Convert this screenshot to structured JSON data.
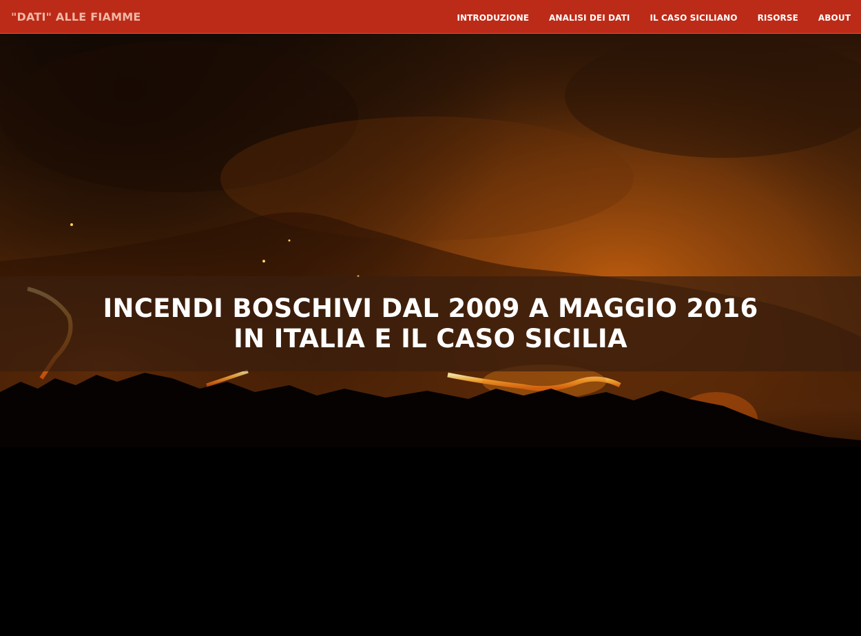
{
  "nav": {
    "brand": "\"DATI\" ALLE FIAMME",
    "links": [
      {
        "label": "INTRODUZIONE"
      },
      {
        "label": "ANALISI DEI DATI"
      },
      {
        "label": "IL CASO SICILIANO"
      },
      {
        "label": "RISORSE"
      },
      {
        "label": "ABOUT"
      }
    ]
  },
  "hero": {
    "title": "INCENDI BOSCHIVI DAL 2009 A MAGGIO 2016 IN ITALIA E IL CASO SICILIA"
  },
  "colors": {
    "navbar_bg": "#bc2b18",
    "brand_text": "#f2b8a6",
    "nav_text": "#ffffff",
    "title_text": "#ffffff"
  }
}
